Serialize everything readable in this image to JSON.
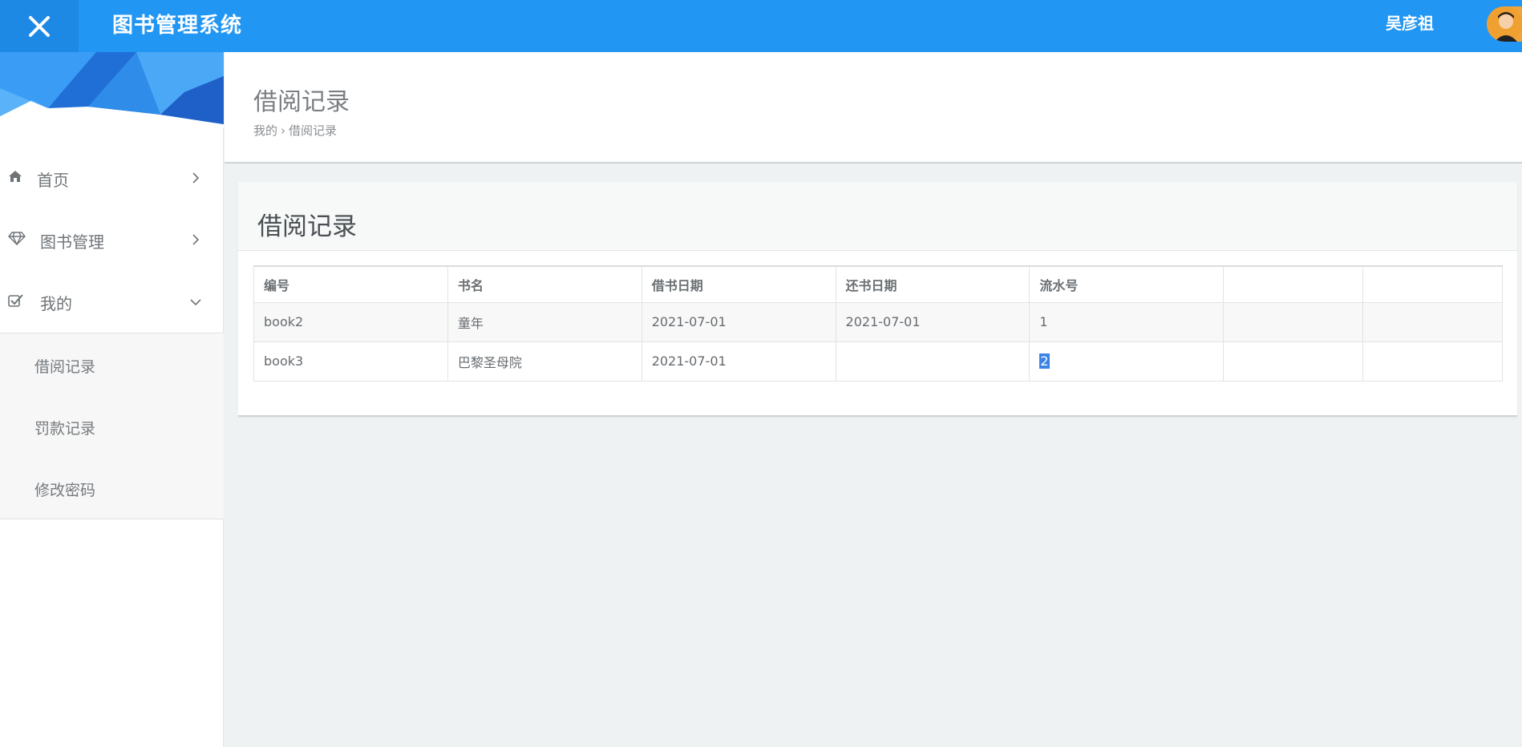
{
  "topbar": {
    "app_title": "图书管理系统",
    "user_name": "吴彦祖",
    "accent_color": "#2196f3"
  },
  "sidebar": {
    "items": [
      {
        "label": "首页",
        "icon": "home-icon"
      },
      {
        "label": "图书管理",
        "icon": "diamond-icon"
      },
      {
        "label": "我的",
        "icon": "check-square-icon",
        "expanded": true
      }
    ],
    "submenu": [
      {
        "label": "借阅记录"
      },
      {
        "label": "罚款记录"
      },
      {
        "label": "修改密码"
      }
    ]
  },
  "header": {
    "title": "借阅记录",
    "breadcrumb": [
      "我的",
      "借阅记录"
    ]
  },
  "panel": {
    "title": "借阅记录",
    "columns": [
      "编号",
      "书名",
      "借书日期",
      "还书日期",
      "流水号",
      "",
      ""
    ],
    "rows": [
      [
        "book2",
        "童年",
        "2021-07-01",
        "2021-07-01",
        "1",
        "",
        ""
      ],
      [
        "book3",
        "巴黎圣母院",
        "2021-07-01",
        "",
        "2",
        "",
        ""
      ]
    ]
  }
}
